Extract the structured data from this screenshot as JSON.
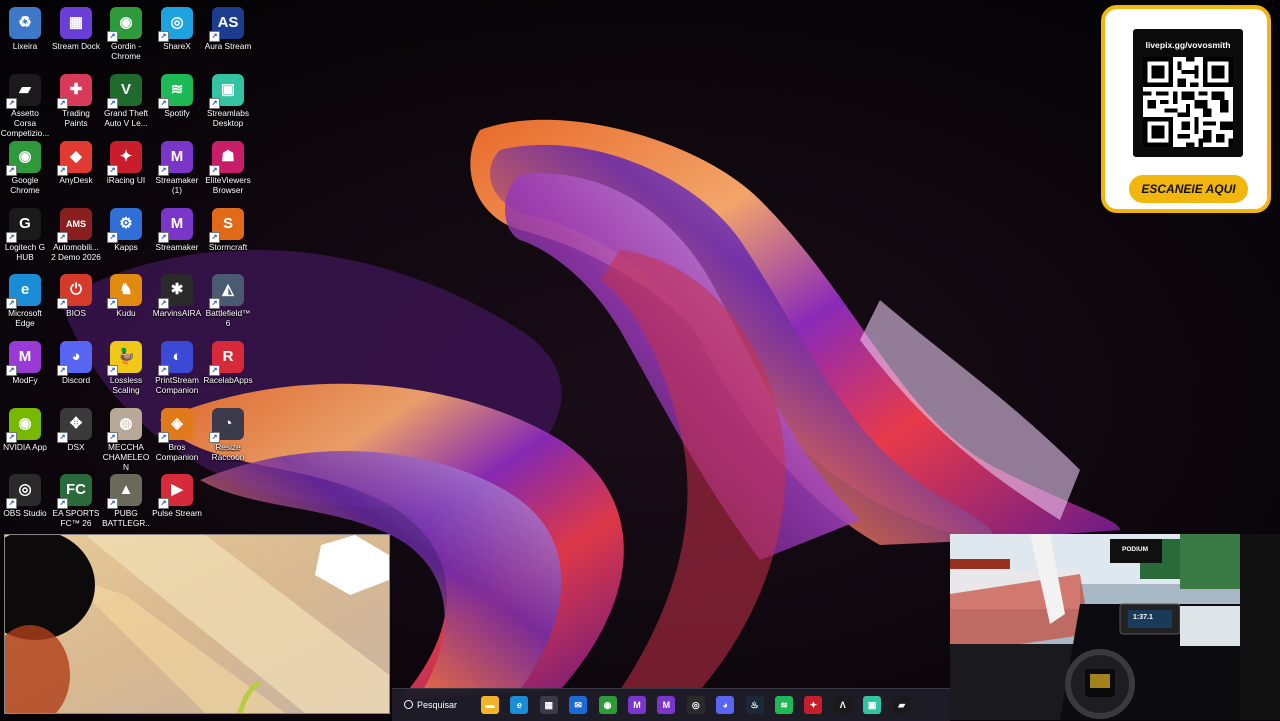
{
  "desktop_icons": [
    {
      "label": "Lixeira",
      "color": "#3d78c9",
      "glyph": "♻",
      "shortcut": false
    },
    {
      "label": "Stream Dock",
      "color": "#6b3ed8",
      "glyph": "▦",
      "shortcut": false
    },
    {
      "label": "Gordin - Chrome",
      "color": "#2f9a3c",
      "glyph": "◉",
      "shortcut": true
    },
    {
      "label": "ShareX",
      "color": "#1fa2e0",
      "glyph": "◎",
      "shortcut": true
    },
    {
      "label": "Aura Stream",
      "color": "#1c3d8f",
      "glyph": "AS",
      "shortcut": true
    },
    {
      "label": "Assetto Corsa Competizio...",
      "color": "#1a1a1a",
      "glyph": "▰",
      "shortcut": true
    },
    {
      "label": "Trading Paints",
      "color": "#d93a5a",
      "glyph": "✚",
      "shortcut": true
    },
    {
      "label": "Grand Theft Auto V Le...",
      "color": "#1f6b2e",
      "glyph": "V",
      "shortcut": true
    },
    {
      "label": "Spotify",
      "color": "#1db954",
      "glyph": "≋",
      "shortcut": true
    },
    {
      "label": "Streamlabs Desktop",
      "color": "#31c3a2",
      "glyph": "▣",
      "shortcut": true
    },
    {
      "label": "Google Chrome",
      "color": "#2f9a3c",
      "glyph": "◉",
      "shortcut": true
    },
    {
      "label": "AnyDesk",
      "color": "#e03a32",
      "glyph": "◆",
      "shortcut": true
    },
    {
      "label": "iRacing UI",
      "color": "#c81e2c",
      "glyph": "✦",
      "shortcut": true
    },
    {
      "label": "Streamaker (1)",
      "color": "#7a35c9",
      "glyph": "M",
      "shortcut": true
    },
    {
      "label": "EliteViewers Browser",
      "color": "#c81e6a",
      "glyph": "☗",
      "shortcut": true
    },
    {
      "label": "Logitech G HUB",
      "color": "#1a1a1a",
      "glyph": "G",
      "shortcut": true
    },
    {
      "label": "Automobili... 2 Demo 2026",
      "color": "#8a1f1f",
      "glyph": "AMS",
      "shortcut": true
    },
    {
      "label": "Kapps",
      "color": "#2f6fd6",
      "glyph": "⚙",
      "shortcut": true
    },
    {
      "label": "Streamaker",
      "color": "#7a35c9",
      "glyph": "M",
      "shortcut": true
    },
    {
      "label": "Stormcraft",
      "color": "#e06a1a",
      "glyph": "S",
      "shortcut": true
    },
    {
      "label": "Microsoft Edge",
      "color": "#1b8dd6",
      "glyph": "e",
      "shortcut": true
    },
    {
      "label": "BIOS",
      "color": "#d63a2a",
      "glyph": "⏻",
      "shortcut": true
    },
    {
      "label": "Kudu",
      "color": "#e08a10",
      "glyph": "♞",
      "shortcut": true
    },
    {
      "label": "MarvinsAIRA",
      "color": "#2a2a2a",
      "glyph": "✱",
      "shortcut": true
    },
    {
      "label": "Battlefield™ 6",
      "color": "#4a5a70",
      "glyph": "◭",
      "shortcut": true
    },
    {
      "label": "ModFy",
      "color": "#9a3ad6",
      "glyph": "M",
      "shortcut": true
    },
    {
      "label": "Discord",
      "color": "#5865f2",
      "glyph": "◕",
      "shortcut": true
    },
    {
      "label": "Lossless Scaling",
      "color": "#f0c81a",
      "glyph": "🦆",
      "shortcut": true
    },
    {
      "label": "PrintStream Companion",
      "color": "#3a4ad6",
      "glyph": "◐",
      "shortcut": true
    },
    {
      "label": "RacelabApps",
      "color": "#d62a3a",
      "glyph": "R",
      "shortcut": true
    },
    {
      "label": "NVIDIA App",
      "color": "#76b900",
      "glyph": "◉",
      "shortcut": true
    },
    {
      "label": "DSX",
      "color": "#3a3a3a",
      "glyph": "✥",
      "shortcut": true
    },
    {
      "label": "MECCHA CHAMELEON",
      "color": "#b8a898",
      "glyph": "◍",
      "shortcut": true
    },
    {
      "label": "Bros Companion",
      "color": "#e07a1a",
      "glyph": "◈",
      "shortcut": true
    },
    {
      "label": "Resize Raccoon",
      "color": "#3a3a4a",
      "glyph": "◔",
      "shortcut": true
    },
    {
      "label": "OBS Studio",
      "color": "#2a2a2a",
      "glyph": "◎",
      "shortcut": true
    },
    {
      "label": "EA SPORTS FC™ 26",
      "color": "#2a6a3a",
      "glyph": "FC",
      "shortcut": true
    },
    {
      "label": "PUBG BATTLEGR...",
      "color": "#6a6a5a",
      "glyph": "▲",
      "shortcut": true
    },
    {
      "label": "Pulse Stream",
      "color": "#d62a3a",
      "glyph": "▶",
      "shortcut": true
    }
  ],
  "qr_card": {
    "url": "livepix.gg/vovosmith",
    "button_label": "ESCANEIE AQUI",
    "accent": "#f2b70f"
  },
  "sim_overlay": {
    "sign_text": "PODIUM",
    "dash_readout": "1:37.1"
  },
  "taskbar": {
    "search_label": "Pesquisar",
    "items": [
      {
        "name": "file-explorer-icon",
        "color": "#f0b429",
        "glyph": "▬"
      },
      {
        "name": "edge-icon",
        "color": "#1b8dd6",
        "glyph": "e"
      },
      {
        "name": "store-icon",
        "color": "#3a3a4a",
        "glyph": "▦"
      },
      {
        "name": "outlook-icon",
        "color": "#1a6ad6",
        "glyph": "✉"
      },
      {
        "name": "chrome-icon",
        "color": "#2f9a3c",
        "glyph": "◉"
      },
      {
        "name": "streamaker-icon",
        "color": "#7a35c9",
        "glyph": "M"
      },
      {
        "name": "streamaker-icon-2",
        "color": "#7a35c9",
        "glyph": "M"
      },
      {
        "name": "obs-icon",
        "color": "#2a2a2a",
        "glyph": "◎"
      },
      {
        "name": "discord-icon",
        "color": "#5865f2",
        "glyph": "◕"
      },
      {
        "name": "steam-icon",
        "color": "#1b2838",
        "glyph": "♨"
      },
      {
        "name": "spotify-icon",
        "color": "#1db954",
        "glyph": "≋"
      },
      {
        "name": "iracing-icon",
        "color": "#c81e2c",
        "glyph": "✦"
      },
      {
        "name": "app-a-icon",
        "color": "#1a1a1a",
        "glyph": "Λ"
      },
      {
        "name": "streamlabs-icon",
        "color": "#31c3a2",
        "glyph": "▣"
      },
      {
        "name": "assetto-icon",
        "color": "#1a1a1a",
        "glyph": "▰"
      }
    ]
  }
}
